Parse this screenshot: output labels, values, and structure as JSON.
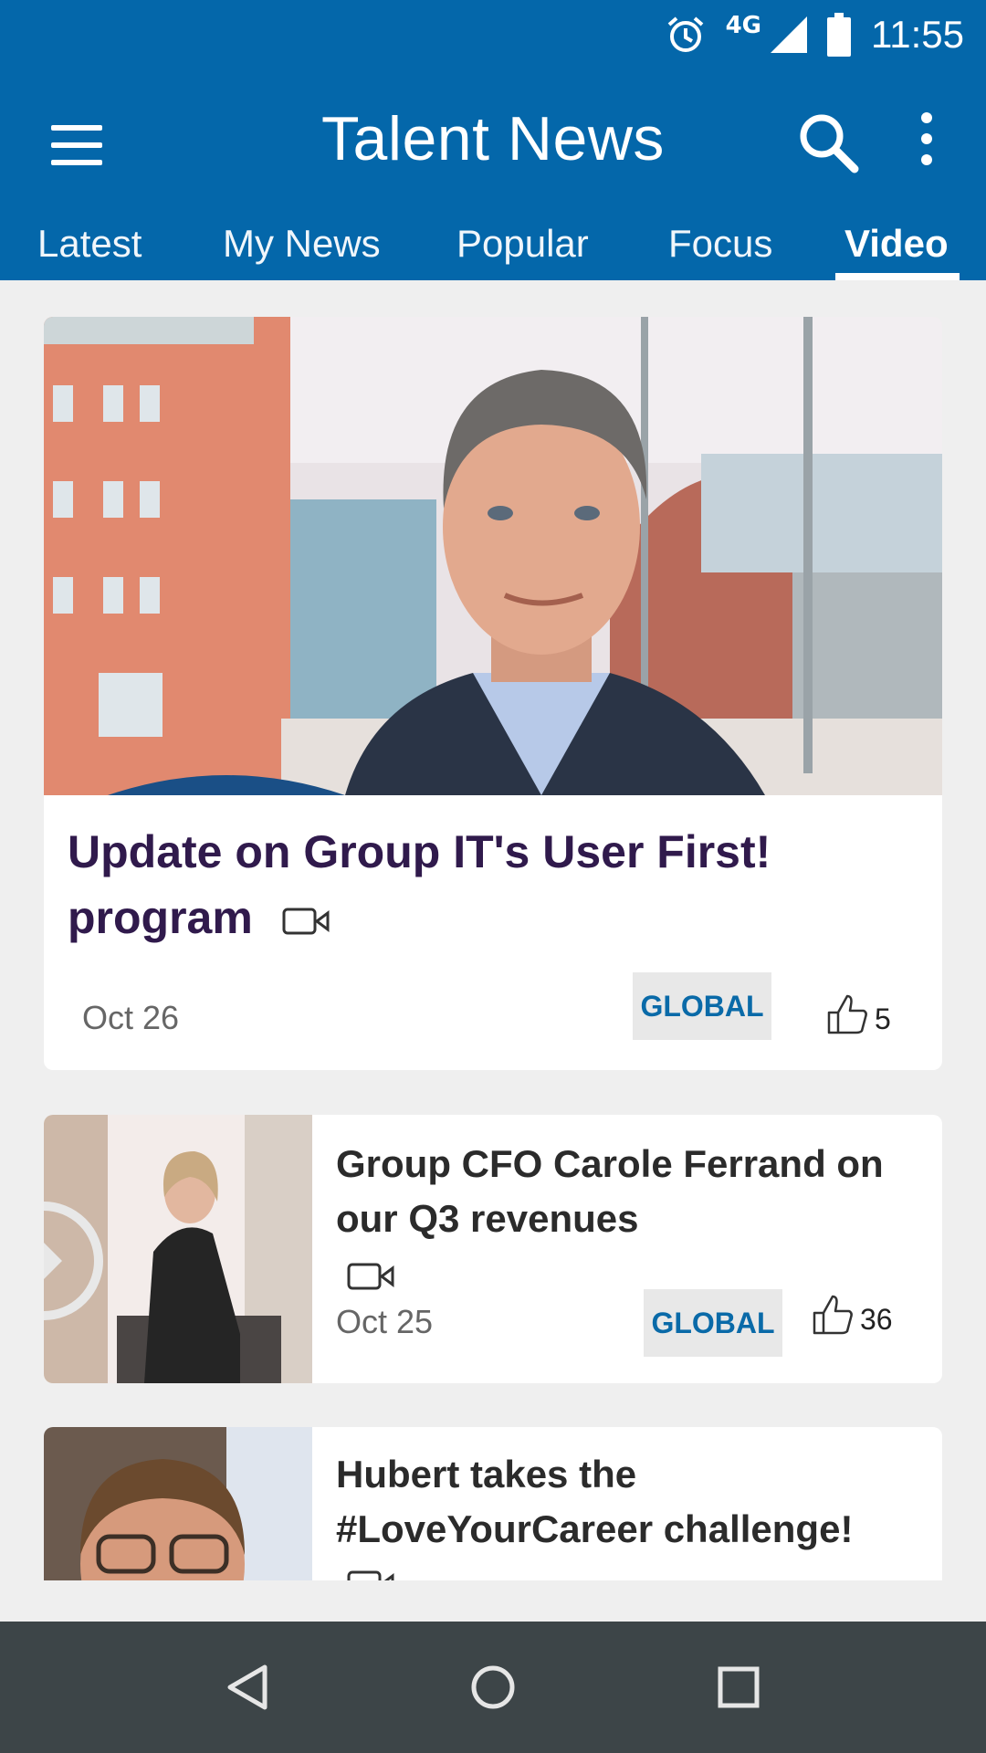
{
  "status_bar": {
    "network": "4G",
    "time": "11:55",
    "icons": [
      "alarm-icon",
      "signal-icon",
      "battery-icon"
    ]
  },
  "app_bar": {
    "title": "Talent News",
    "icons": [
      "menu-icon",
      "search-icon",
      "more-vert-icon"
    ]
  },
  "tabs": [
    {
      "label": "Latest",
      "active": false
    },
    {
      "label": "My News",
      "active": false
    },
    {
      "label": "Popular",
      "active": false
    },
    {
      "label": "Focus",
      "active": false
    },
    {
      "label": "Video",
      "active": true
    }
  ],
  "articles": [
    {
      "title": "Update on Group IT's User First! program",
      "date": "Oct 26",
      "tag": "GLOBAL",
      "likes": "5",
      "type": "video"
    },
    {
      "title": "Group CFO Carole Ferrand on our Q3 revenues",
      "date": "Oct 25",
      "tag": "GLOBAL",
      "likes": "36",
      "type": "video"
    },
    {
      "title": "Hubert takes the #LoveYourCareer challenge!",
      "type": "video"
    }
  ],
  "colors": {
    "primary": "#0467aa",
    "headline": "#301a4c",
    "tag_text": "#0a6aa8",
    "nav_bar": "#3d4548",
    "background": "#efefef"
  },
  "nav_bar": {
    "icons": [
      "back-icon",
      "home-icon",
      "recents-icon"
    ]
  }
}
